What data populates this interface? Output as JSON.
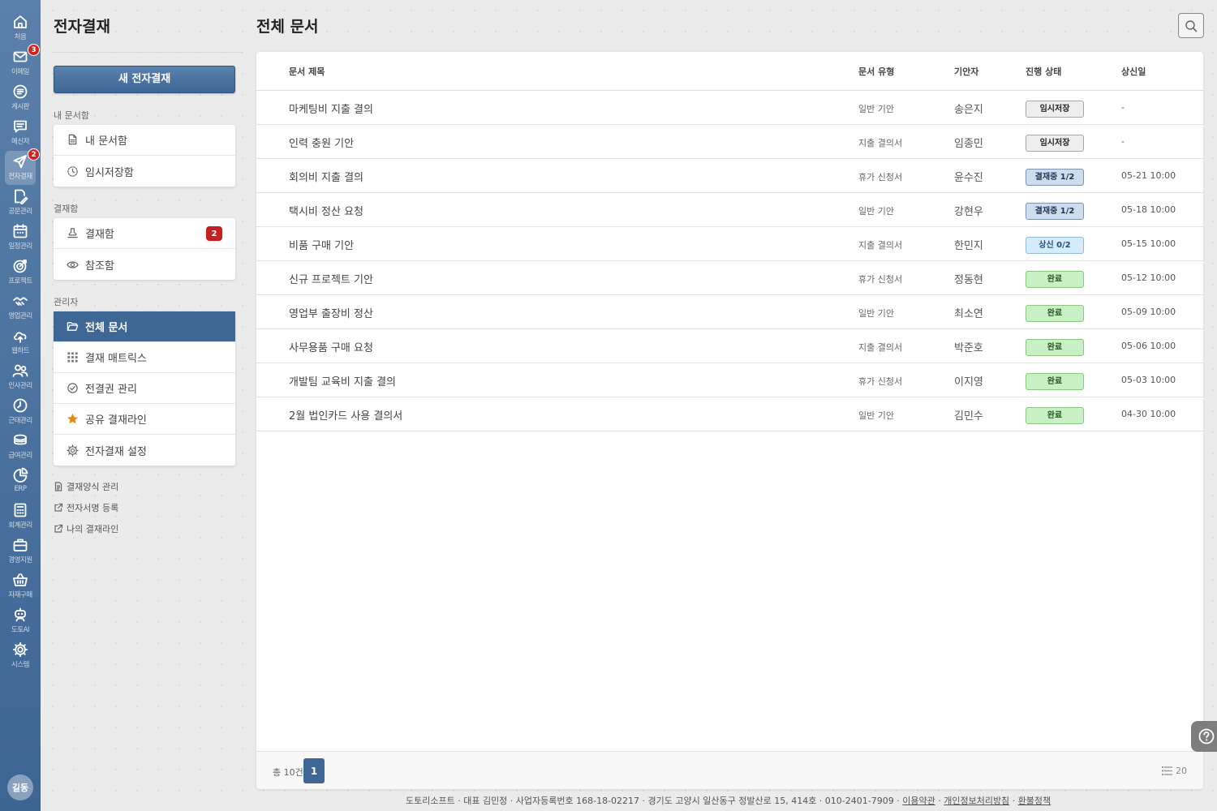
{
  "rail": {
    "items": [
      {
        "label": "처음",
        "icon": "home-icon"
      },
      {
        "label": "이메일",
        "icon": "mail-icon",
        "badge": "3"
      },
      {
        "label": "게시판",
        "icon": "board-icon"
      },
      {
        "label": "메신저",
        "icon": "messenger-icon"
      },
      {
        "label": "전자결재",
        "icon": "send-icon",
        "badge": "2",
        "active": true
      },
      {
        "label": "공문관리",
        "icon": "document-edit-icon"
      },
      {
        "label": "일정관리",
        "icon": "calendar-icon"
      },
      {
        "label": "프로젝트",
        "icon": "target-icon"
      },
      {
        "label": "영업관리",
        "icon": "handshake-icon"
      },
      {
        "label": "웹하드",
        "icon": "cloud-upload-icon"
      },
      {
        "label": "인사관리",
        "icon": "people-icon"
      },
      {
        "label": "근태관리",
        "icon": "clock-icon"
      },
      {
        "label": "급여관리",
        "icon": "coins-icon"
      },
      {
        "label": "ERP",
        "icon": "pie-chart-icon"
      },
      {
        "label": "회계관리",
        "icon": "calculator-icon"
      },
      {
        "label": "경영지원",
        "icon": "briefcase-icon"
      },
      {
        "label": "자재구매",
        "icon": "basket-icon"
      },
      {
        "label": "도토AI",
        "icon": "robot-icon"
      },
      {
        "label": "시스템",
        "icon": "gear-icon"
      }
    ],
    "avatar": "길동"
  },
  "sidebar": {
    "title": "전자결재",
    "new_button": "새 전자결재",
    "groups": [
      {
        "label": "내 문서함",
        "items": [
          {
            "label": "내 문서함",
            "icon": "file-icon"
          },
          {
            "label": "임시저장함",
            "icon": "clock-dashed-icon"
          }
        ]
      },
      {
        "label": "결재함",
        "items": [
          {
            "label": "결재함",
            "icon": "stamp-icon",
            "badge": "2"
          },
          {
            "label": "참조함",
            "icon": "eye-icon"
          }
        ]
      },
      {
        "label": "관리자",
        "items": [
          {
            "label": "전체 문서",
            "icon": "folder-open-icon",
            "active": true
          },
          {
            "label": "결재 매트릭스",
            "icon": "grid-icon"
          },
          {
            "label": "전결권 관리",
            "icon": "check-circle-icon"
          },
          {
            "label": "공유 결재라인",
            "icon": "star-icon"
          },
          {
            "label": "전자결재 설정",
            "icon": "gear-icon"
          }
        ]
      }
    ],
    "extra_links": [
      {
        "label": "결재양식 관리",
        "icon": "form-icon"
      },
      {
        "label": "전자서명 등록",
        "icon": "external-link-icon"
      },
      {
        "label": "나의 결재라인",
        "icon": "external-link-icon"
      }
    ]
  },
  "main": {
    "title": "전체 문서",
    "columns": [
      "문서 제목",
      "문서 유형",
      "기안자",
      "진행 상태",
      "상신일"
    ],
    "rows": [
      {
        "title": "마케팅비 지출 결의",
        "type": "일반 기안",
        "author": "송은지",
        "status": "임시저장",
        "status_kind": "draft",
        "date": "-"
      },
      {
        "title": "인력 충원 기안",
        "type": "지출 결의서",
        "author": "임종민",
        "status": "임시저장",
        "status_kind": "draft",
        "date": "-"
      },
      {
        "title": "회의비 지출 결의",
        "type": "휴가 신청서",
        "author": "윤수진",
        "status": "결재중 1/2",
        "status_kind": "progress",
        "date": "05-21 10:00"
      },
      {
        "title": "택시비 정산 요청",
        "type": "일반 기안",
        "author": "강현우",
        "status": "결재중 1/2",
        "status_kind": "progress",
        "date": "05-18 10:00"
      },
      {
        "title": "비품 구매 기안",
        "type": "지출 결의서",
        "author": "한민지",
        "status": "상신 0/2",
        "status_kind": "submit",
        "date": "05-15 10:00"
      },
      {
        "title": "신규 프로젝트 기안",
        "type": "휴가 신청서",
        "author": "정동현",
        "status": "완료",
        "status_kind": "done",
        "date": "05-12 10:00"
      },
      {
        "title": "영업부 출장비 정산",
        "type": "일반 기안",
        "author": "최소연",
        "status": "완료",
        "status_kind": "done",
        "date": "05-09 10:00"
      },
      {
        "title": "사무용품 구매 요청",
        "type": "지출 결의서",
        "author": "박준호",
        "status": "완료",
        "status_kind": "done",
        "date": "05-06 10:00"
      },
      {
        "title": "개발팀 교육비 지출 결의",
        "type": "휴가 신청서",
        "author": "이지영",
        "status": "완료",
        "status_kind": "done",
        "date": "05-03 10:00"
      },
      {
        "title": "2월 법인카드 사용 결의서",
        "type": "일반 기안",
        "author": "김민수",
        "status": "완료",
        "status_kind": "done",
        "date": "04-30 10:00"
      }
    ],
    "total": "총 10건",
    "page": "1",
    "per_page": "20"
  },
  "footer": {
    "company": "도토리소프트 · 대표 김민정 · 사업자등록번호 168-18-02217 · 경기도 고양시 일산동구 정발산로 15, 414호 · 010-2401-7909 ·",
    "links": [
      "이용약관",
      "개인정보처리방침",
      "환불정책"
    ],
    "sep": "·"
  },
  "colors": {
    "accent": "#3f6795",
    "badge_red": "#c62020",
    "status_done": "#c9efc4",
    "status_progress": "#cfdceb",
    "status_submit": "#d6ebfb",
    "status_draft": "#eeeeee"
  }
}
